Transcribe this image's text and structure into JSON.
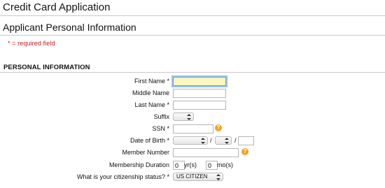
{
  "page": {
    "title": "Credit Card Application",
    "subtitle": "Applicant Personal Information",
    "required_note": "* = required field",
    "section_title": "PERSONAL INFORMATION"
  },
  "form": {
    "first_name": {
      "label": "First Name *",
      "value": ""
    },
    "middle_name": {
      "label": "Middle Name",
      "value": ""
    },
    "last_name": {
      "label": "Last Name *",
      "value": ""
    },
    "suffix": {
      "label": "Suffix",
      "value": ""
    },
    "ssn": {
      "label": "SSN *",
      "value": "",
      "help": "?"
    },
    "dob": {
      "label": "Date of Birth *",
      "month": "",
      "day": "",
      "year": "",
      "sep1": "/",
      "sep2": "/"
    },
    "member_number": {
      "label": "Member Number",
      "value": "",
      "help": "?"
    },
    "membership_duration": {
      "label": "Membership Duration",
      "years": "0",
      "years_unit": "yr(s)",
      "months": "0",
      "months_unit": "mo(s)"
    },
    "citizenship": {
      "label": "What is your citizenship status? *",
      "value": "US CITIZEN"
    }
  },
  "colors": {
    "required": "#d4141b",
    "help_icon": "#f2a11c",
    "focus_bg": "#fbf7c1"
  }
}
